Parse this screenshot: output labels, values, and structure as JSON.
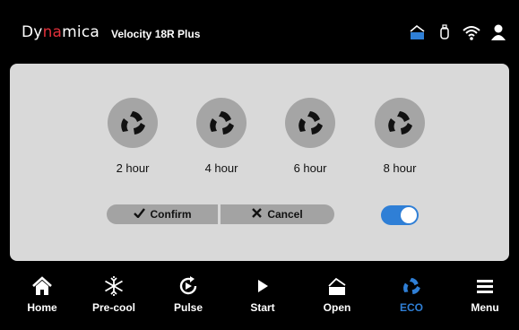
{
  "header": {
    "brand_prefix": "Dy",
    "brand_accent": "na",
    "brand_suffix": "mica",
    "model": "Velocity 18R Plus",
    "status_icons": [
      "lid-open-icon",
      "usb-icon",
      "wifi-icon",
      "user-icon"
    ]
  },
  "timers": [
    {
      "label": "2 hour",
      "icon": "eco-icon"
    },
    {
      "label": "4 hour",
      "icon": "eco-icon"
    },
    {
      "label": "6 hour",
      "icon": "eco-icon"
    },
    {
      "label": "8 hour",
      "icon": "eco-icon"
    }
  ],
  "actions": {
    "confirm_label": "Confirm",
    "cancel_label": "Cancel"
  },
  "toggle": {
    "on": true
  },
  "nav": [
    {
      "label": "Home",
      "icon": "home-icon"
    },
    {
      "label": "Pre-cool",
      "icon": "snowflake-icon"
    },
    {
      "label": "Pulse",
      "icon": "pulse-icon"
    },
    {
      "label": "Start",
      "icon": "play-icon"
    },
    {
      "label": "Open",
      "icon": "lid-open-icon"
    },
    {
      "label": "ECO",
      "icon": "eco-icon",
      "active": true
    },
    {
      "label": "Menu",
      "icon": "menu-icon"
    }
  ],
  "colors": {
    "accent": "#2f7fd6",
    "brand_red": "#e0303a",
    "panel": "#d9d9d9",
    "button": "#a3a3a3"
  }
}
